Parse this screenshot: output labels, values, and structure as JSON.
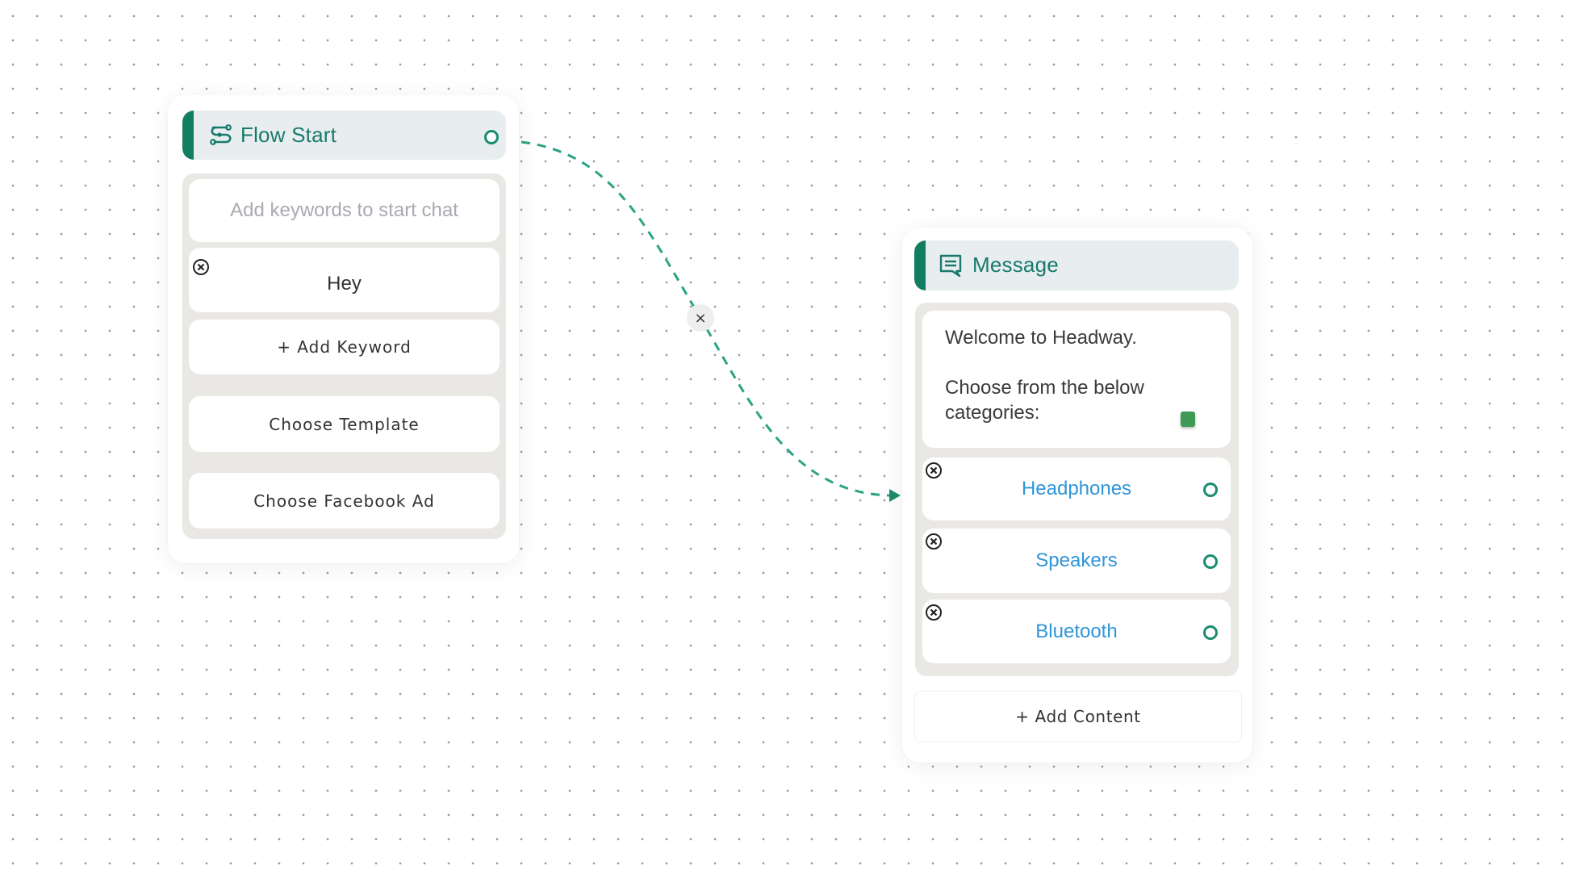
{
  "colors": {
    "accent": "#117e62",
    "handle": "#1a8c6e",
    "edge": "#2aa385",
    "option_text": "#2f95d8",
    "header_bg": "#e8eeef",
    "tray_bg": "#e9e8e4",
    "status_square": "#3f9a55"
  },
  "flow_start": {
    "icon": "flow-route-icon",
    "title": "Flow Start",
    "keyword_input": {
      "placeholder": "Add keywords to start chat",
      "value": ""
    },
    "keywords": [
      {
        "label": "Hey",
        "remove_icon": "remove-circle-icon"
      }
    ],
    "add_keyword_label": "+ Add Keyword",
    "choose_template_label": "Choose Template",
    "choose_facebook_ad_label": "Choose Facebook Ad"
  },
  "edge": {
    "from": "Flow Start",
    "to": "Message",
    "delete_label": "×",
    "style": "dashed"
  },
  "message": {
    "icon": "message-icon",
    "title": "Message",
    "body": "Welcome to Headway.\n\nChoose from the below categories:",
    "options": [
      {
        "label": "Headphones"
      },
      {
        "label": "Speakers"
      },
      {
        "label": "Bluetooth"
      }
    ],
    "add_content_label": "+ Add Content"
  }
}
